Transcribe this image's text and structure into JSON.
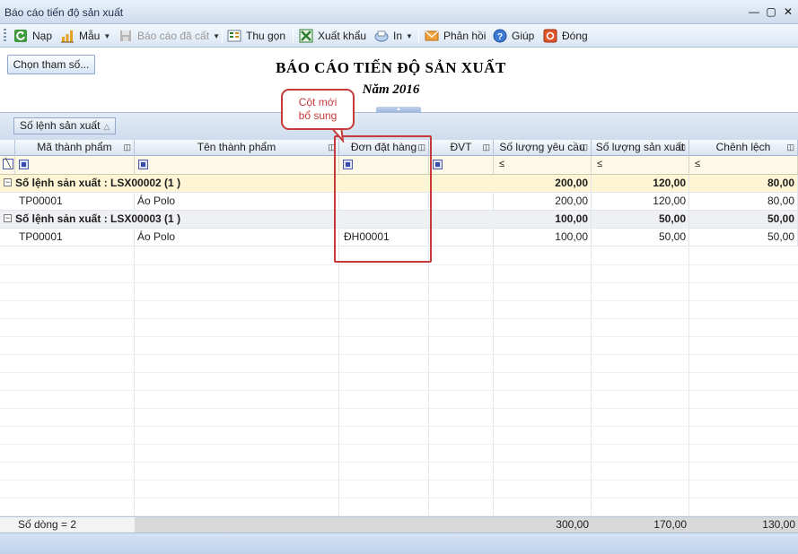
{
  "window": {
    "title": "Báo cáo tiến độ sản xuất"
  },
  "toolbar": {
    "items": [
      {
        "label": "Nạp",
        "icon": "refresh-icon"
      },
      {
        "label": "Mẫu",
        "icon": "template-chart-icon"
      },
      {
        "label": "Báo cáo đã cất",
        "icon": "saved-report-icon",
        "disabled": true
      },
      {
        "label": "Thu gọn",
        "icon": "collapse-icon"
      },
      {
        "label": "Xuất khẩu",
        "icon": "excel-export-icon"
      },
      {
        "label": "In",
        "icon": "print-icon"
      },
      {
        "label": "Phản hồi",
        "icon": "feedback-mail-icon"
      },
      {
        "label": "Giúp",
        "icon": "help-icon"
      },
      {
        "label": "Đóng",
        "icon": "close-app-icon"
      }
    ]
  },
  "report": {
    "choose_params_label": "Chọn tham số...",
    "title": "BÁO CÁO TIẾN ĐỘ SẢN XUẤT",
    "subtitle": "Năm 2016"
  },
  "group_panel": {
    "group_chip_label": "Số lệnh sản xuất"
  },
  "grid": {
    "columns": [
      "Mã thành phẩm",
      "Tên thành phẩm",
      "Đơn đặt hàng",
      "ĐVT",
      "Số lượng yêu cầu",
      "Số lượng sản xuất",
      "Chênh lệch"
    ],
    "filter_le": "≤",
    "groups": [
      {
        "label": "Số lệnh sản xuất : LSX00002 (1 )",
        "totals": {
          "required": "200,00",
          "produced": "120,00",
          "difference": "80,00"
        },
        "rows": [
          {
            "code": "TP00001",
            "name": "Áo Polo",
            "order": "",
            "unit": "",
            "required": "200,00",
            "produced": "120,00",
            "difference": "80,00"
          }
        ]
      },
      {
        "label": "Số lệnh sản xuất : LSX00003 (1 )",
        "totals": {
          "required": "100,00",
          "produced": "50,00",
          "difference": "50,00"
        },
        "rows": [
          {
            "code": "TP00001",
            "name": "Áo Polo",
            "order": "ĐH00001",
            "unit": "",
            "required": "100,00",
            "produced": "50,00",
            "difference": "50,00"
          }
        ]
      }
    ],
    "footer": {
      "row_count": "Số dòng = 2",
      "required": "300,00",
      "produced": "170,00",
      "difference": "130,00"
    }
  },
  "annotation": {
    "line1": "Cột mới",
    "line2": "bổ sung"
  },
  "colors": {
    "callout_red": "#c63a3a",
    "group_row_yellow": "#fdf5d4",
    "filter_row": "#fdf9e6"
  }
}
